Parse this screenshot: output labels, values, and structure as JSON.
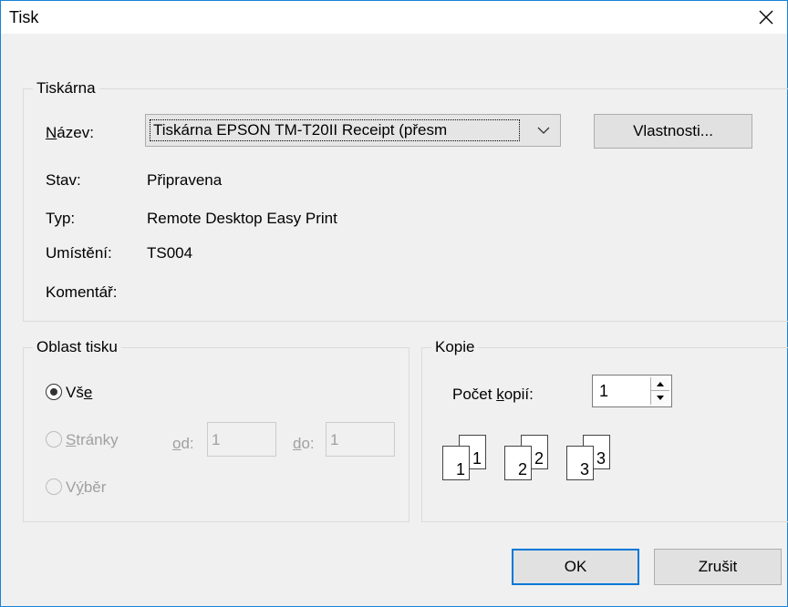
{
  "window": {
    "title": "Tisk"
  },
  "printer_group": {
    "legend": "Tiskárna",
    "name_label": "Název:",
    "name_value": "Tiskárna EPSON TM-T20II Receipt (přesm",
    "properties_button": "Vlastnosti...",
    "status_label": "Stav:",
    "status_value": "Připravena",
    "type_label": "Typ:",
    "type_value": "Remote Desktop Easy Print",
    "location_label": "Umístění:",
    "location_value": "TS004",
    "comment_label": "Komentář:",
    "comment_value": ""
  },
  "range_group": {
    "legend": "Oblast tisku",
    "all_label": "Vše",
    "pages_label": "Stránky",
    "from_label": "od:",
    "from_value": "1",
    "to_label": "do:",
    "to_value": "1",
    "selection_label": "Výběr",
    "selected": "all"
  },
  "copies_group": {
    "legend": "Kopie",
    "count_label": "Počet kopií:",
    "count_value": "1",
    "collate_pages": [
      "1",
      "1",
      "2",
      "2",
      "3",
      "3"
    ]
  },
  "buttons": {
    "ok": "OK",
    "cancel": "Zrušit"
  },
  "icons": [
    "close-icon",
    "chevron-down-icon",
    "spin-up-icon",
    "spin-down-icon",
    "collate-pages-icon"
  ]
}
